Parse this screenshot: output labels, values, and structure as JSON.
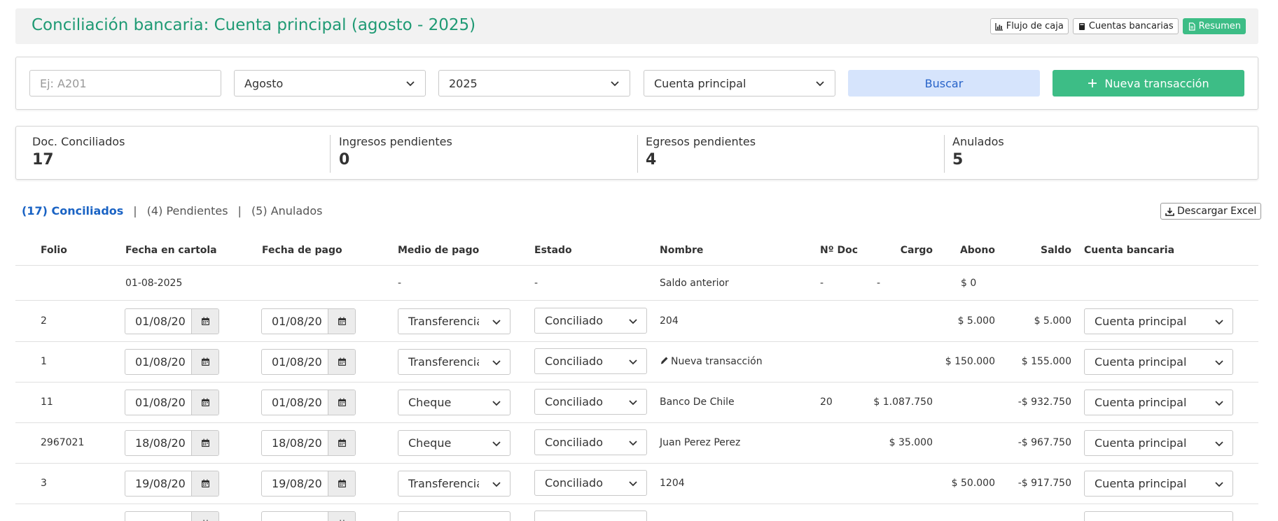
{
  "header": {
    "title": "Conciliación bancaria: Cuenta principal (agosto - 2025)",
    "buttons": {
      "cashflow": "Flujo de caja",
      "bank_accounts": "Cuentas bancarias",
      "summary": "Resumen"
    }
  },
  "filters": {
    "search_placeholder": "Ej: A201",
    "month": "Agosto",
    "year": "2025",
    "account": "Cuenta principal",
    "search_button": "Buscar",
    "new_button": "Nueva transacción"
  },
  "stats": [
    {
      "label": "Doc. Conciliados",
      "value": "17"
    },
    {
      "label": "Ingresos pendientes",
      "value": "0"
    },
    {
      "label": "Egresos pendientes",
      "value": "4"
    },
    {
      "label": "Anulados",
      "value": "5"
    }
  ],
  "tabs": {
    "reconciled": "(17) Conciliados",
    "pending": "(4) Pendientes",
    "voided": "(5) Anulados",
    "separator": "|"
  },
  "excel_button": "Descargar Excel",
  "table": {
    "columns": {
      "folio": "Folio",
      "statement_date": "Fecha en cartola",
      "payment_date": "Fecha de pago",
      "payment_method": "Medio de pago",
      "status": "Estado",
      "name": "Nombre",
      "doc_no": "Nº Doc",
      "charge": "Cargo",
      "credit": "Abono",
      "balance": "Saldo",
      "bank_account": "Cuenta bancaria"
    },
    "opening_row": {
      "date": "01-08-2025",
      "method": "-",
      "status": "-",
      "name": "Saldo anterior",
      "doc_no": "-",
      "charge": "-",
      "credit": "$ 0"
    },
    "rows": [
      {
        "folio": "2",
        "statement_date": "01/08/20",
        "payment_date": "01/08/20",
        "method": "Transferencia",
        "status": "Conciliado",
        "name": "204",
        "name_icon": "",
        "doc_no": "",
        "charge": "",
        "credit": "$ 5.000",
        "balance": "$ 5.000",
        "account": "Cuenta principal"
      },
      {
        "folio": "1",
        "statement_date": "01/08/20",
        "payment_date": "01/08/20",
        "method": "Transferencia",
        "status": "Conciliado",
        "name": "Nueva transacción",
        "name_icon": "pencil-icon",
        "doc_no": "",
        "charge": "",
        "credit": "$ 150.000",
        "balance": "$ 155.000",
        "account": "Cuenta principal"
      },
      {
        "folio": "11",
        "statement_date": "01/08/20",
        "payment_date": "01/08/20",
        "method": "Cheque",
        "status": "Conciliado",
        "name": "Banco De Chile",
        "name_icon": "",
        "doc_no": "20",
        "charge": "$ 1.087.750",
        "credit": "",
        "balance": "-$ 932.750",
        "account": "Cuenta principal"
      },
      {
        "folio": "2967021",
        "statement_date": "18/08/20",
        "payment_date": "18/08/20",
        "method": "Cheque",
        "status": "Conciliado",
        "name": "Juan Perez Perez",
        "name_icon": "",
        "doc_no": "",
        "charge": "$ 35.000",
        "credit": "",
        "balance": "-$ 967.750",
        "account": "Cuenta principal"
      },
      {
        "folio": "3",
        "statement_date": "19/08/20",
        "payment_date": "19/08/20",
        "method": "Transferencia",
        "status": "Conciliado",
        "name": "1204",
        "name_icon": "",
        "doc_no": "",
        "charge": "",
        "credit": "$ 50.000",
        "balance": "-$ 917.750",
        "account": "Cuenta principal"
      },
      {
        "folio": "",
        "statement_date": "",
        "payment_date": "",
        "method": "",
        "status": "",
        "name": "",
        "name_icon": "",
        "doc_no": "",
        "charge": "",
        "credit": "",
        "balance": "",
        "account": ""
      }
    ]
  },
  "colors": {
    "title_green": "#1f9a74",
    "accent_green": "#3dbd86",
    "link_blue": "#1a63c4",
    "search_btn_bg": "#d6e4fc"
  }
}
